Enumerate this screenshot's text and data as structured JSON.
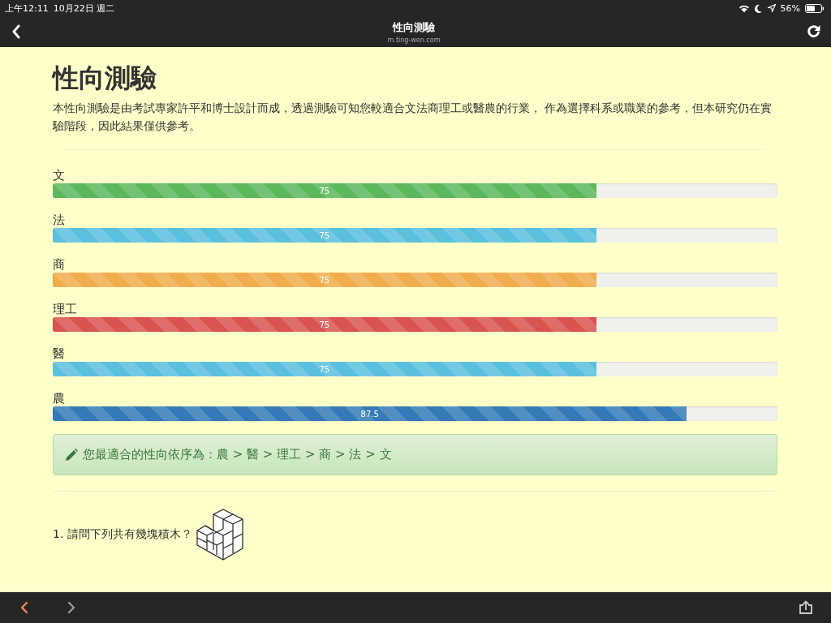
{
  "status_bar": {
    "time": "上午12:11",
    "date": "10月22日 週二",
    "battery": "56%"
  },
  "nav_bar": {
    "title": "性向測驗",
    "url": "m.ting-wen.com"
  },
  "page": {
    "title": "性向測驗",
    "description": "本性向測驗是由考試專家許平和博士設計而成，透過測驗可知您較適合文法商理工或醫農的行業， 作為選擇科系或職業的參考，但本研究仍在實驗階段，因此結果僅供參考。",
    "results": [
      {
        "label": "文",
        "reading": "75",
        "level": 0.75,
        "color": "#5cb85c"
      },
      {
        "label": "法",
        "reading": "75",
        "level": 0.75,
        "color": "#5bc0de"
      },
      {
        "label": "商",
        "reading": "75",
        "level": 0.75,
        "color": "#f0ad4e"
      },
      {
        "label": "理工",
        "reading": "75",
        "level": 0.75,
        "color": "#d9534f"
      },
      {
        "label": "醫",
        "reading": "75",
        "level": 0.75,
        "color": "#5bc0de"
      },
      {
        "label": "農",
        "reading": "87.5",
        "level": 0.875,
        "color": "#337ab7"
      }
    ],
    "summary": "您最適合的性向依序為：農 > 醫 > 理工 > 商 > 法 > 文",
    "question": "1. 請問下列共有幾塊積木？"
  },
  "toolbar": {
    "back_enabled": true,
    "forward_enabled": false
  }
}
